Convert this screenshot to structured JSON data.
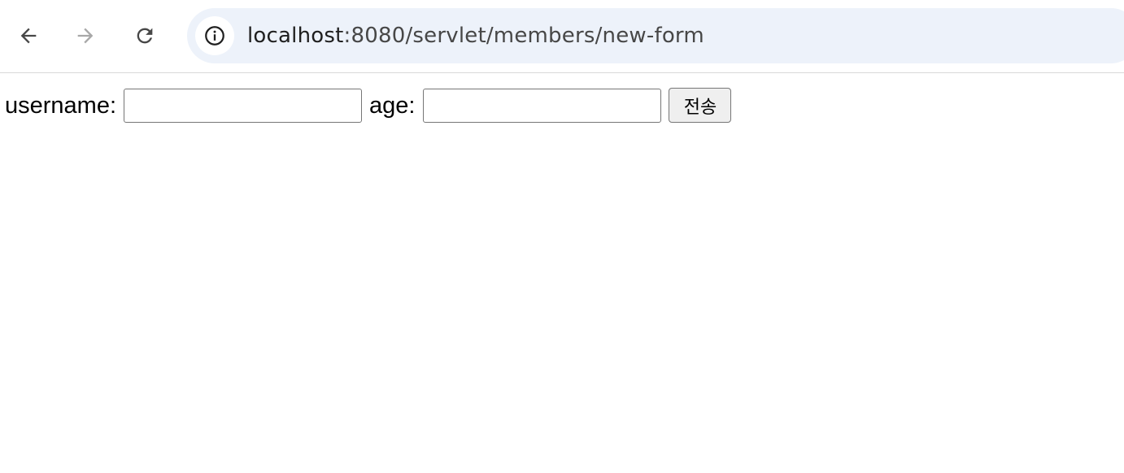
{
  "browser": {
    "icons": {
      "back": "arrow-left-icon",
      "forward": "arrow-right-icon",
      "reload": "reload-icon",
      "site_info": "info-icon"
    },
    "url_host": "localhost",
    "url_rest": ":8080/servlet/members/new-form",
    "colors": {
      "omnibox_bg": "#edf2fa",
      "icon_active": "#474747",
      "icon_disabled": "#a8a8a8"
    }
  },
  "form": {
    "username_label": "username:",
    "username_value": "",
    "age_label": "age:",
    "age_value": "",
    "submit_label": "전송"
  }
}
